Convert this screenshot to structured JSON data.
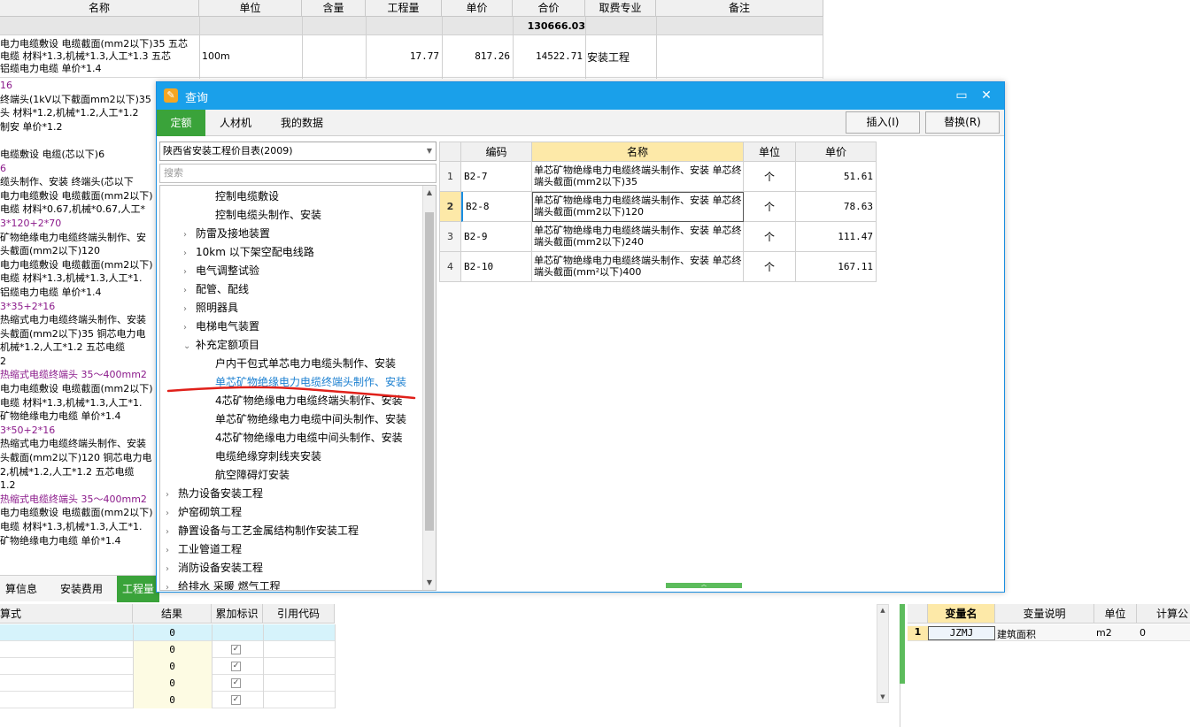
{
  "bg": {
    "headers": [
      "名称",
      "单位",
      "含量",
      "工程量",
      "单价",
      "合价",
      "取费专业",
      "备注"
    ],
    "total": "130666.03",
    "row1": {
      "name_lines": [
        "电力电缆敷设 电缆截面(mm2以下)35  五芯",
        "电缆 材料*1.3,机械*1.3,人工*1.3  五芯",
        "铝缆电力电缆 单价*1.4"
      ],
      "unit": "100m",
      "qty": "17.77",
      "price": "817.26",
      "total": "14522.71",
      "specialty": "安装工程"
    },
    "left_lines": [
      {
        "t": "16",
        "c": "purple"
      },
      {
        "t": "终端头(1kV以下截面mm2以下)35",
        "c": ""
      },
      {
        "t": "头 材料*1.2,机械*1.2,人工*1.2",
        "c": ""
      },
      {
        "t": "制安 单价*1.2",
        "c": ""
      },
      {
        "t": "",
        "c": ""
      },
      {
        "t": "电缆敷设 电缆(芯以下)6",
        "c": ""
      },
      {
        "t": "6",
        "c": "purple"
      },
      {
        "t": "缆头制作、安装 终端头(芯以下",
        "c": ""
      },
      {
        "t": "电力电缆敷设 电缆截面(mm2以下)",
        "c": ""
      },
      {
        "t": "电缆 材料*0.67,机械*0.67,人工*",
        "c": ""
      },
      {
        "t": "3*120+2*70",
        "c": "purple"
      },
      {
        "t": "矿物绝缘电力电缆终端头制作、安",
        "c": ""
      },
      {
        "t": "头截面(mm2以下)120",
        "c": ""
      },
      {
        "t": "电力电缆敷设 电缆截面(mm2以下)",
        "c": ""
      },
      {
        "t": "电缆 材料*1.3,机械*1.3,人工*1.",
        "c": ""
      },
      {
        "t": "铝缆电力电缆 单价*1.4",
        "c": ""
      },
      {
        "t": "3*35+2*16",
        "c": "purple"
      },
      {
        "t": "热缩式电力电缆终端头制作、安装",
        "c": ""
      },
      {
        "t": "头截面(mm2以下)35  铜芯电力电",
        "c": ""
      },
      {
        "t": "机械*1.2,人工*1.2  五芯电缆",
        "c": ""
      },
      {
        "t": "2",
        "c": ""
      },
      {
        "t": "热缩式电缆终端头 35～400mm2",
        "c": "purple"
      },
      {
        "t": "电力电缆敷设 电缆截面(mm2以下)",
        "c": ""
      },
      {
        "t": "电缆 材料*1.3,机械*1.3,人工*1.",
        "c": ""
      },
      {
        "t": "矿物绝缘电力电缆 单价*1.4",
        "c": ""
      },
      {
        "t": "3*50+2*16",
        "c": "purple"
      },
      {
        "t": "热缩式电力电缆终端头制作、安装",
        "c": ""
      },
      {
        "t": "头截面(mm2以下)120  铜芯电力电",
        "c": ""
      },
      {
        "t": "2,机械*1.2,人工*1.2  五芯电缆",
        "c": ""
      },
      {
        "t": "1.2",
        "c": ""
      },
      {
        "t": "热缩式电缆终端头 35～400mm2",
        "c": "purple"
      },
      {
        "t": "电力电缆敷设 电缆截面(mm2以下)",
        "c": ""
      },
      {
        "t": "电缆 材料*1.3,机械*1.3,人工*1.",
        "c": ""
      },
      {
        "t": "矿物绝缘电力电缆 单价*1.4",
        "c": ""
      }
    ]
  },
  "dialog": {
    "title": "查询",
    "window_buttons": {
      "maximize": "▭",
      "close": "✕"
    },
    "tabs": [
      "定额",
      "人材机",
      "我的数据"
    ],
    "insert_label": "插入(I)",
    "replace_label": "替换(R)",
    "library": "陕西省安装工程价目表(2009)",
    "search_placeholder": "搜索",
    "tree": [
      {
        "label": "控制电缆敷设",
        "level": 2,
        "chev": "",
        "sel": false
      },
      {
        "label": "控制电缆头制作、安装",
        "level": 2,
        "chev": "",
        "sel": false
      },
      {
        "label": "防雷及接地装置",
        "level": 1,
        "chev": "›",
        "sel": false
      },
      {
        "label": "10km 以下架空配电线路",
        "level": 1,
        "chev": "›",
        "sel": false
      },
      {
        "label": "电气调整试验",
        "level": 1,
        "chev": "›",
        "sel": false
      },
      {
        "label": "配管、配线",
        "level": 1,
        "chev": "›",
        "sel": false
      },
      {
        "label": "照明器具",
        "level": 1,
        "chev": "›",
        "sel": false
      },
      {
        "label": "电梯电气装置",
        "level": 1,
        "chev": "›",
        "sel": false
      },
      {
        "label": "补充定额项目",
        "level": 1,
        "chev": "⌄",
        "sel": false
      },
      {
        "label": "户内干包式单芯电力电缆头制作、安装",
        "level": 2,
        "chev": "",
        "sel": false
      },
      {
        "label": "单芯矿物绝缘电力电缆终端头制作、安装",
        "level": 2,
        "chev": "",
        "sel": true
      },
      {
        "label": "4芯矿物绝缘电力电缆终端头制作、安装",
        "level": 2,
        "chev": "",
        "sel": false
      },
      {
        "label": "单芯矿物绝缘电力电缆中间头制作、安装",
        "level": 2,
        "chev": "",
        "sel": false
      },
      {
        "label": "4芯矿物绝缘电力电缆中间头制作、安装",
        "level": 2,
        "chev": "",
        "sel": false
      },
      {
        "label": "电缆绝缘穿刺线夹安装",
        "level": 2,
        "chev": "",
        "sel": false
      },
      {
        "label": "航空障碍灯安装",
        "level": 2,
        "chev": "",
        "sel": false
      },
      {
        "label": "热力设备安装工程",
        "level": 0,
        "chev": "›",
        "sel": false
      },
      {
        "label": "炉窑砌筑工程",
        "level": 0,
        "chev": "›",
        "sel": false
      },
      {
        "label": "静置设备与工艺金属结构制作安装工程",
        "level": 0,
        "chev": "›",
        "sel": false
      },
      {
        "label": "工业管道工程",
        "level": 0,
        "chev": "›",
        "sel": false
      },
      {
        "label": "消防设备安装工程",
        "level": 0,
        "chev": "›",
        "sel": false
      },
      {
        "label": "给排水 采暖 燃气工程",
        "level": 0,
        "chev": "›",
        "sel": false
      }
    ],
    "table": {
      "headers": [
        "",
        "编码",
        "名称",
        "单位",
        "单价"
      ],
      "rows": [
        {
          "n": "1",
          "code": "B2-7",
          "name": "单芯矿物绝缘电力电缆终端头制作、安装 单芯终端头截面(mm2以下)35",
          "unit": "个",
          "price": "51.61"
        },
        {
          "n": "2",
          "code": "B2-8",
          "name": "单芯矿物绝缘电力电缆终端头制作、安装 单芯终端头截面(mm2以下)120",
          "unit": "个",
          "price": "78.63"
        },
        {
          "n": "3",
          "code": "B2-9",
          "name": "单芯矿物绝缘电力电缆终端头制作、安装 单芯终端头截面(mm2以下)240",
          "unit": "个",
          "price": "111.47"
        },
        {
          "n": "4",
          "code": "B2-10",
          "name": "单芯矿物绝缘电力电缆终端头制作、安装 单芯终端头截面(mm²以下)400",
          "unit": "个",
          "price": "167.11"
        }
      ]
    }
  },
  "bottom": {
    "tabs": [
      "算信息",
      "安装费用",
      "工程量"
    ],
    "grid_headers": [
      "算式",
      "结果",
      "累加标识",
      "引用代码"
    ],
    "results": [
      "0",
      "0",
      "0",
      "0",
      "0"
    ],
    "var_headers": [
      "变量名",
      "变量说明",
      "单位",
      "计算公"
    ],
    "var_row": {
      "n": "1",
      "name": "JZMJ",
      "desc": "建筑面积",
      "unit": "m2",
      "val": "0"
    }
  }
}
